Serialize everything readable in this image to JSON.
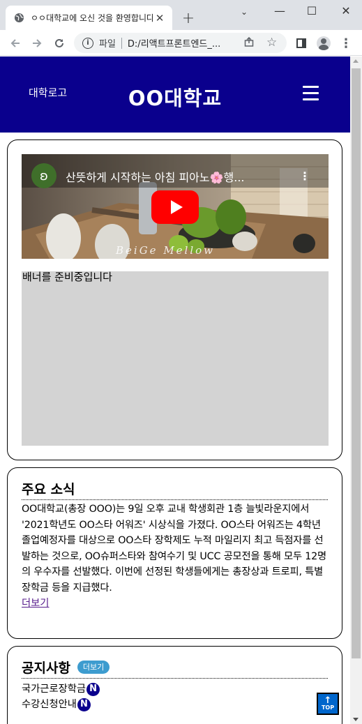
{
  "browser": {
    "tab_title": "ㅇㅇ대학교에 오신 것을 환영합니다",
    "tab_close": "✕",
    "new_tab": "+",
    "address_scheme": "파일",
    "address_url": "D:/리액트프론트엔드_...",
    "window_buttons": {
      "minimize": "—",
      "maximize": "☐",
      "close": "✕",
      "tabsearch": "⌄"
    }
  },
  "header": {
    "logo": "대학로고",
    "title": "OO대학교"
  },
  "video": {
    "title": "산뜻하게 시작하는 아침 피아노🌸행...",
    "watermark": "BeiGe Mellow"
  },
  "banner": {
    "text": "배너를 준비중입니다"
  },
  "news": {
    "title": "주요 소식",
    "body": "OO대학교(총장 OOO)는 9일 오후 교내 학생회관 1층 늘빛라운지에서 '2021학년도 OO스타 어워즈' 시상식을 가졌다. OO스타 어워즈는 4학년 졸업예정자를 대상으로 OO스타 장학제도 누적 마일리지 최고 득점자를 선발하는 것으로, OO슈퍼스타와 참여수기 및 UCC 공모전을 통해 모두 12명의 우수자를 선발했다. 이번에 선정된 학생들에게는 총장상과 트로피, 특별장학금 등을 지급했다.",
    "more": "더보기"
  },
  "notice": {
    "title": "공지사항",
    "more": "더보기",
    "items": [
      {
        "label": "국가근로장학금",
        "badge": "N"
      },
      {
        "label": "수강신청안내",
        "badge": "N"
      }
    ]
  },
  "top_button": {
    "arrow": "↑",
    "label": "TOP"
  },
  "colors": {
    "header_bg": "#0a008d",
    "badge_blue": "#3d9ccf",
    "top_btn": "#0066cc"
  }
}
